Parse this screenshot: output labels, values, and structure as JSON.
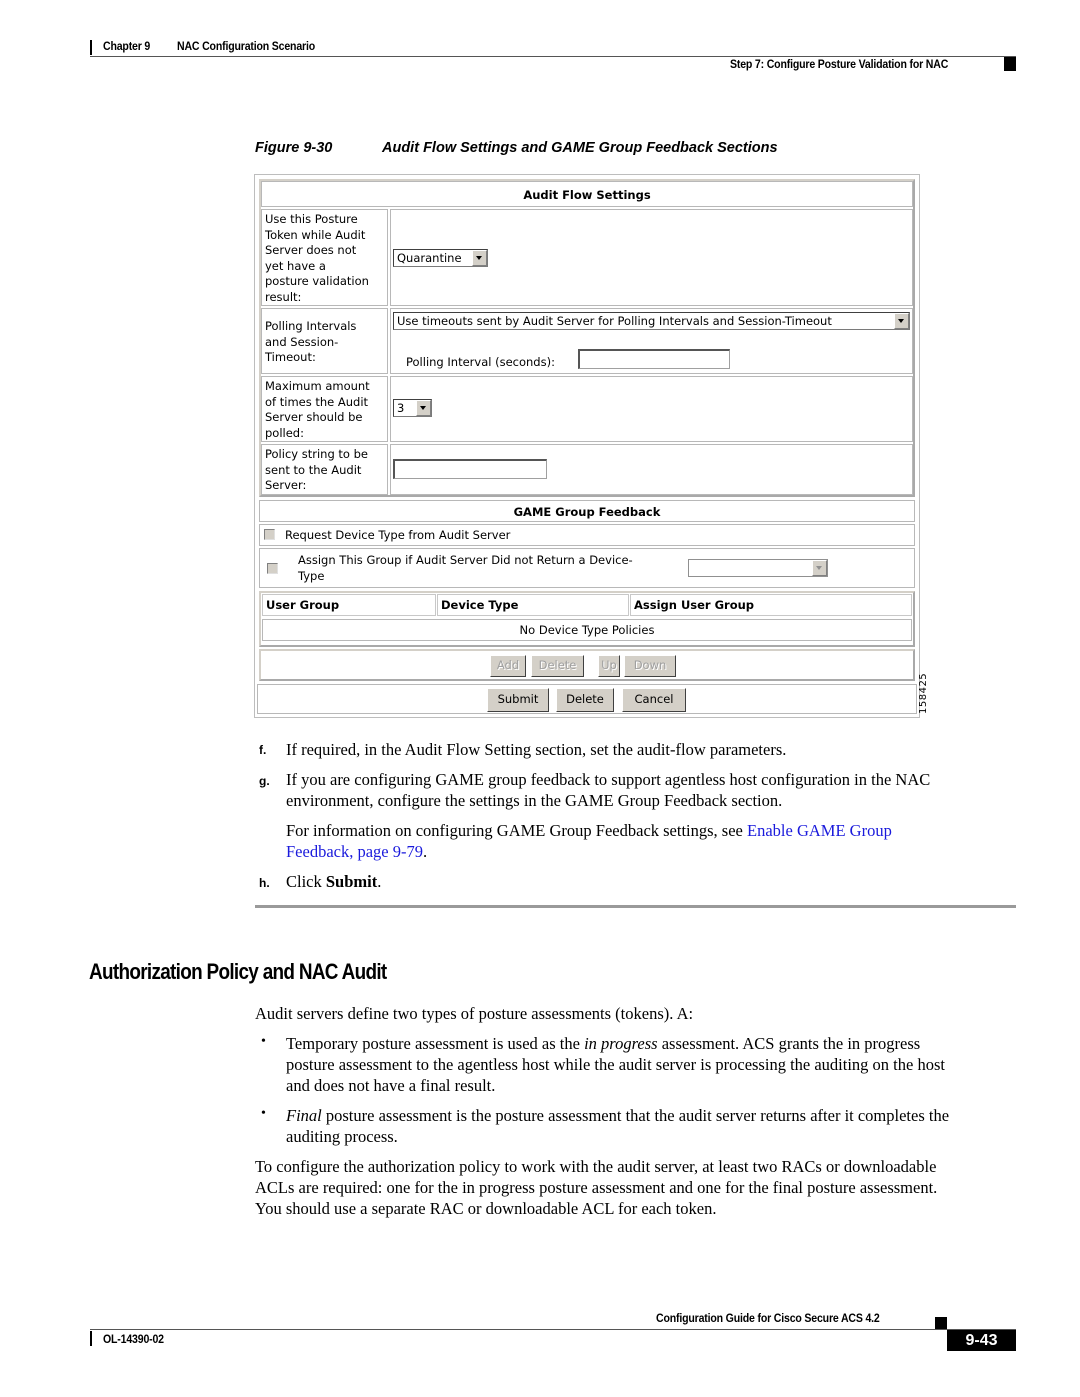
{
  "header": {
    "chapter": "Chapter 9",
    "chapter_title": "NAC Configuration Scenario",
    "section": "Step 7: Configure Posture Validation for NAC"
  },
  "figure": {
    "number": "Figure 9-30",
    "title": "Audit Flow Settings and GAME Group Feedback Sections",
    "id": "158425"
  },
  "ui": {
    "audit_flow": {
      "title": "Audit Flow Settings",
      "posture_token_label": [
        "Use this Posture",
        "Token while Audit",
        "Server does not",
        "yet have a",
        "posture validation",
        "result:"
      ],
      "posture_token_value": "Quarantine",
      "polling_label": [
        "Polling Intervals",
        "and Session-",
        "Timeout:"
      ],
      "polling_value": "Use timeouts sent by Audit Server for Polling Intervals and Session-Timeout",
      "polling_interval_label": "Polling Interval (seconds):",
      "polling_interval_value": "",
      "max_polls_label": [
        "Maximum amount",
        "of times the Audit",
        "Server should be",
        "polled:"
      ],
      "max_polls_value": "3",
      "policy_string_label": [
        "Policy string to be",
        "sent to the Audit",
        "Server:"
      ],
      "policy_string_value": ""
    },
    "game_feedback": {
      "title": "GAME Group Feedback",
      "request_device_type_label": "Request Device Type from Audit Server",
      "request_device_type_checked": false,
      "assign_group_label": [
        "Assign This Group if Audit Server Did not Return a Device-",
        "Type"
      ],
      "assign_group_checked": false,
      "assign_group_value": "",
      "table": {
        "columns": [
          "User Group",
          "Device Type",
          "Assign User Group"
        ],
        "empty_message": "No Device Type Policies"
      },
      "row_buttons": [
        "Add",
        "Delete",
        "Up",
        "Down"
      ]
    },
    "form_buttons": [
      "Submit",
      "Delete",
      "Cancel"
    ]
  },
  "steps": [
    {
      "label": "f.",
      "text": "If required, in the Audit Flow Setting section, set the audit-flow parameters."
    },
    {
      "label": "g.",
      "text_lines": [
        "If you are configuring GAME group feedback to support agentless host configuration in the NAC",
        "environment, configure the settings in the GAME Group Feedback section."
      ],
      "info_prefix": "For information on configuring GAME Group Feedback settings, see ",
      "info_link_line1": "Enable GAME Group",
      "info_link_line2": "Feedback, page 9-79",
      "info_suffix": "."
    },
    {
      "label": "h.",
      "text_prefix": "Click ",
      "text_bold": "Submit",
      "text_suffix": "."
    }
  ],
  "section": {
    "heading": "Authorization Policy and NAC Audit",
    "intro": "Audit servers define two types of posture assessments (tokens). A:",
    "bullets": [
      {
        "lines": [
          "Temporary posture assessment is used as the ",
          "in progress",
          " assessment. ACS grants the in progress",
          "posture assessment to the agentless host while the audit server is processing the auditing on the host",
          "and does not have a final result."
        ]
      },
      {
        "lines": [
          "Final",
          " posture assessment is the posture assessment that the audit server returns after it completes the",
          "auditing process."
        ]
      }
    ],
    "closing": [
      "To configure the authorization policy to work with the audit server, at least two RACs or downloadable",
      "ACLs are required: one for the in progress posture assessment and one for the final posture assessment.",
      "You should use a separate RAC or downloadable ACL for each token."
    ]
  },
  "footer": {
    "guide_title": "Configuration Guide for Cisco Secure ACS 4.2",
    "doc_number": "OL-14390-02",
    "page_number": "9-43"
  }
}
